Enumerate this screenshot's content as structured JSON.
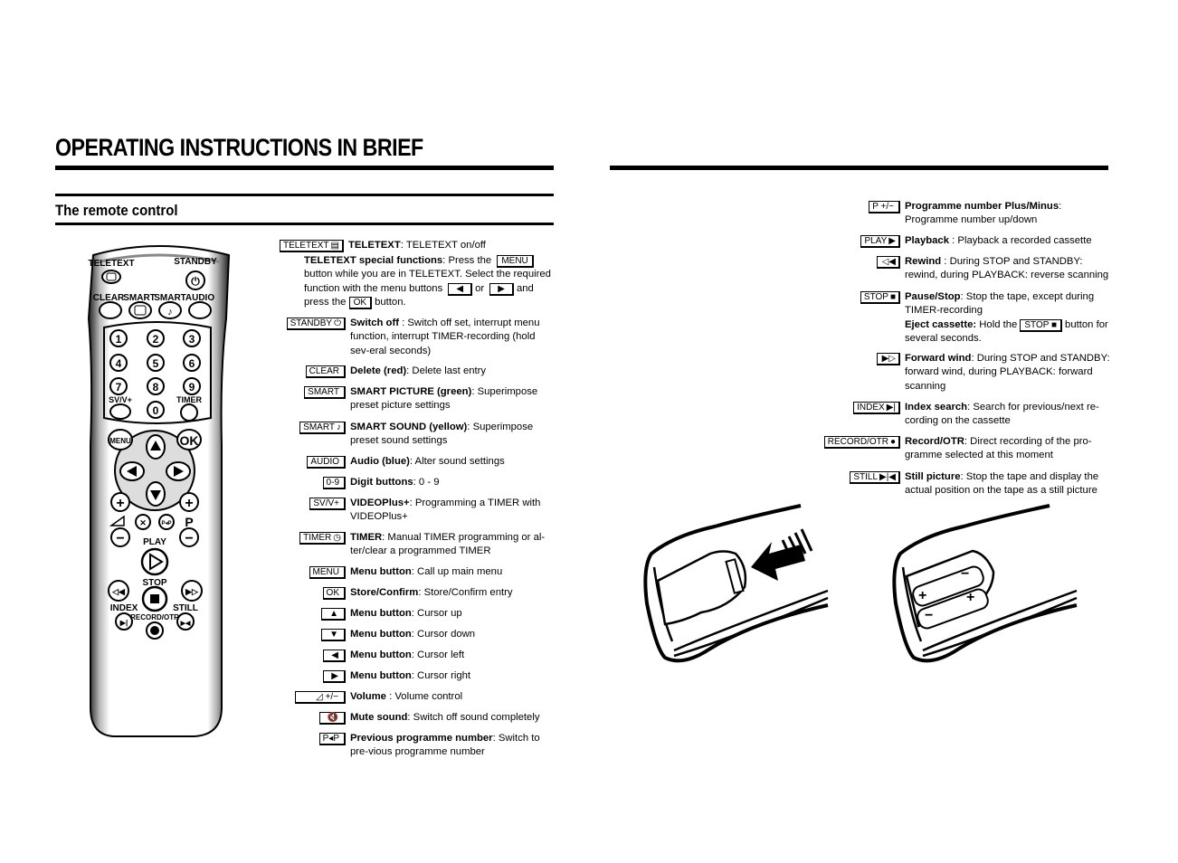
{
  "header": {
    "title": "OPERATING INSTRUCTIONS IN BRIEF",
    "section": "The remote control"
  },
  "remote_labels": {
    "teletext": "TELETEXT",
    "standby": "STANDBY",
    "clear": "CLEAR",
    "smart1": "SMART",
    "smart2": "SMART",
    "audio": "AUDIO",
    "svv": "SV/V+",
    "timer": "TIMER",
    "menu": "MENU",
    "ok": "OK",
    "play": "PLAY",
    "stop": "STOP",
    "index": "INDEX",
    "still": "STILL",
    "record": "RECORD/OTR",
    "p": "P",
    "digits": [
      "1",
      "2",
      "3",
      "4",
      "5",
      "6",
      "7",
      "8",
      "9",
      "0"
    ]
  },
  "left_entries": [
    {
      "key": "TELETEXT",
      "icon": "▤",
      "title": "TELETEXT",
      "text": ": TELETEXT on/off"
    },
    {
      "key": "STANDBY",
      "icon": "⏻",
      "title": "Switch off",
      "text": " : Switch off set, interrupt menu function, interrupt TIMER-recording (hold sev-eral seconds)"
    },
    {
      "key": "CLEAR",
      "icon": "",
      "title": "Delete (red)",
      "text": ": Delete last entry"
    },
    {
      "key": "SMART",
      "icon": "",
      "title": "SMART PICTURE (green)",
      "text": ": Superimpose preset picture settings"
    },
    {
      "key": "SMART",
      "icon": "♪",
      "title": "SMART SOUND (yellow)",
      "text": ": Superimpose preset sound settings"
    },
    {
      "key": "AUDIO",
      "icon": "",
      "title": "Audio (blue)",
      "text": ": Alter sound settings"
    },
    {
      "key": "0-9",
      "icon": "",
      "title": "Digit buttons",
      "text": ": 0 - 9"
    },
    {
      "key": "SV/V+",
      "icon": "",
      "title": "VIDEOPlus+",
      "text": ": Programming a TIMER with VIDEOPlus+"
    },
    {
      "key": "TIMER",
      "icon": "◷",
      "title": "TIMER",
      "text": ": Manual TIMER programming or al-ter/clear a programmed TIMER"
    },
    {
      "key": "MENU",
      "icon": "",
      "title": "Menu button",
      "text": ": Call up main menu"
    },
    {
      "key": "OK",
      "icon": "",
      "title": "Store/Confirm",
      "text": ": Store/Confirm entry"
    },
    {
      "key": "",
      "icon": "▲",
      "title": "Menu button",
      "text": ": Cursor up"
    },
    {
      "key": "",
      "icon": "▼",
      "title": "Menu button",
      "text": ": Cursor down"
    },
    {
      "key": "",
      "icon": "◀",
      "title": "Menu button",
      "text": ": Cursor left"
    },
    {
      "key": "",
      "icon": "▶",
      "title": "Menu button",
      "text": ": Cursor right"
    },
    {
      "key": "",
      "icon": "◿ +/−",
      "title": "Volume",
      "text": " : Volume control"
    },
    {
      "key": "",
      "icon": "🔇",
      "title": "Mute sound",
      "text": ": Switch off sound completely"
    },
    {
      "key": "P◂P",
      "icon": "",
      "title": "Previous programme number",
      "text": ": Switch to pre-vious programme number"
    }
  ],
  "teletext_special": {
    "title": "TELETEXT special functions",
    "t1": ": Press the",
    "menu_key": "MENU",
    "t2": "button while you are in TELETEXT. Select the required function with the menu buttons",
    "left_key": "◀",
    "or": "or",
    "right_key": "▶",
    "t3": "and press the",
    "ok_key": "OK",
    "t4": "button."
  },
  "right_entries": [
    {
      "key": "P +/−",
      "icon": "",
      "title": "Programme number Plus/Minus",
      "text": ": Programme number up/down"
    },
    {
      "key": "PLAY",
      "icon": "▶",
      "title": "Playback",
      "text": " : Playback a recorded cassette"
    },
    {
      "key": "",
      "icon": "◁◀",
      "title": "Rewind",
      "text": " : During STOP and STANDBY: rewind, during PLAYBACK: reverse scanning"
    },
    {
      "key": "STOP",
      "icon": "■",
      "title": "Pause/Stop",
      "text": ": Stop the tape, except during TIMER-recording"
    },
    {
      "key": "",
      "icon": "▶▷",
      "title": "Forward wind",
      "text": ": During STOP and STANDBY: forward wind, during PLAYBACK: forward scanning"
    },
    {
      "key": "INDEX",
      "icon": "▶|",
      "title": "Index search",
      "text": ": Search for previous/next re-cording on the cassette"
    },
    {
      "key": "RECORD/OTR",
      "icon": "●",
      "title": "Record/OTR",
      "text": ": Direct recording of the pro-gramme selected at this moment"
    },
    {
      "key": "STILL",
      "icon": "▶|◀",
      "title": "Still picture",
      "text": ": Stop the tape and display the actual position on the tape as a still picture"
    }
  ],
  "eject": {
    "title": "Eject cassette:",
    "t1": "Hold the",
    "key": "STOP ■",
    "t2": "button for several seconds."
  }
}
